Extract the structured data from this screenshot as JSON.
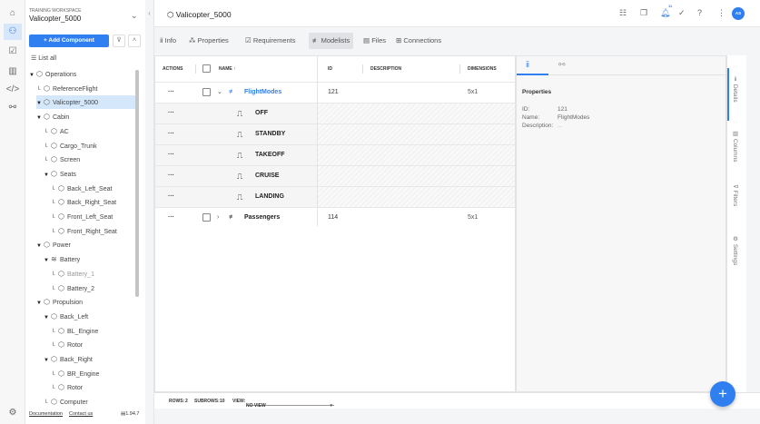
{
  "header": {
    "title": "Valicopter_5000",
    "notification_count": "11",
    "avatar": "AS"
  },
  "workspace": {
    "label": "TRAINING WORKSPACE",
    "name": "Valicopter_5000"
  },
  "sidebar": {
    "add_label": "+ Add Component",
    "list_all": "List all",
    "tree": [
      {
        "label": "Operations",
        "level": 0,
        "exp": true
      },
      {
        "label": "ReferenceFlight",
        "level": 1
      },
      {
        "label": "Valicopter_5000",
        "level": 0,
        "exp": true,
        "selected": true
      },
      {
        "label": "Cabin",
        "level": 1,
        "exp": true
      },
      {
        "label": "AC",
        "level": 2
      },
      {
        "label": "Cargo_Trunk",
        "level": 2
      },
      {
        "label": "Screen",
        "level": 2
      },
      {
        "label": "Seats",
        "level": 2,
        "exp": true
      },
      {
        "label": "Back_Left_Seat",
        "level": 3
      },
      {
        "label": "Back_Right_Seat",
        "level": 3
      },
      {
        "label": "Front_Left_Seat",
        "level": 3
      },
      {
        "label": "Front_Right_Seat",
        "level": 3
      },
      {
        "label": "Power",
        "level": 1,
        "exp": true
      },
      {
        "label": "Battery",
        "level": 2,
        "exp": true,
        "stack": true
      },
      {
        "label": "Battery_1",
        "level": 3,
        "grey": true
      },
      {
        "label": "Battery_2",
        "level": 3
      },
      {
        "label": "Propulsion",
        "level": 1,
        "exp": true
      },
      {
        "label": "Back_Left",
        "level": 2,
        "exp": true
      },
      {
        "label": "BL_Engine",
        "level": 3
      },
      {
        "label": "Rotor",
        "level": 3
      },
      {
        "label": "Back_Right",
        "level": 2,
        "exp": true
      },
      {
        "label": "BR_Engine",
        "level": 3
      },
      {
        "label": "Rotor",
        "level": 3
      },
      {
        "label": "Computer",
        "level": 2
      }
    ],
    "footer": {
      "documentation": "Documentation",
      "contact": "Contact us",
      "version": "1.94.7"
    }
  },
  "tabs": [
    {
      "label": "Info",
      "icon": "ⅱ"
    },
    {
      "label": "Properties",
      "icon": "⁂"
    },
    {
      "label": "Requirements",
      "icon": "☑"
    },
    {
      "label": "Modelists",
      "icon": "≢",
      "active": true
    },
    {
      "label": "Files",
      "icon": "▤"
    },
    {
      "label": "Connections",
      "icon": "⊞"
    }
  ],
  "grid": {
    "columns": {
      "actions": "ACTIONS",
      "name": "NAME",
      "id": "ID",
      "description": "DESCRIPTION",
      "dimensions": "DIMENSIONS"
    },
    "rows": [
      {
        "type": "list",
        "name": "FlightModes",
        "id": "121",
        "dims": "5x1",
        "expanded": true,
        "link": true
      },
      {
        "type": "sub",
        "name": "OFF"
      },
      {
        "type": "sub",
        "name": "STANDBY"
      },
      {
        "type": "sub",
        "name": "TAKEOFF"
      },
      {
        "type": "sub",
        "name": "CRUISE"
      },
      {
        "type": "sub",
        "name": "LANDING"
      },
      {
        "type": "list",
        "name": "Passengers",
        "id": "114",
        "dims": "5x1"
      }
    ],
    "footer": {
      "rows_label": "ROWS:",
      "rows": "2",
      "subrows_label": "SUBROWS:",
      "subrows": "10",
      "view_label": "VIEW:",
      "view": "NO VIEW"
    }
  },
  "details": {
    "heading": "Properties",
    "id_label": "ID:",
    "id": "121",
    "name_label": "Name:",
    "name": "FlightModes",
    "desc_label": "Description:",
    "desc": "..."
  },
  "side_tabs": [
    "Details",
    "Columns",
    "Filters",
    "Settings"
  ],
  "accent": "#2f7ff0"
}
